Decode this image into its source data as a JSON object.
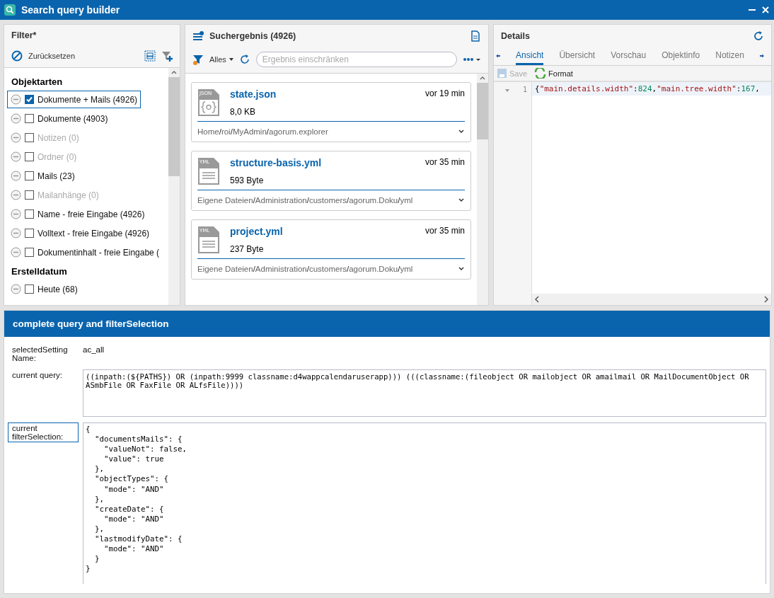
{
  "window": {
    "title": "Search query builder"
  },
  "filter": {
    "title": "Filter*",
    "reset": "Zurücksetzen",
    "groups": [
      {
        "title": "Objektarten",
        "items": [
          {
            "label": "Dokumente + Mails (4926)",
            "checked": true,
            "disabled": false,
            "selected": true
          },
          {
            "label": "Dokumente (4903)",
            "checked": false,
            "disabled": false,
            "selected": false
          },
          {
            "label": "Notizen (0)",
            "checked": false,
            "disabled": true,
            "selected": false
          },
          {
            "label": "Ordner (0)",
            "checked": false,
            "disabled": true,
            "selected": false
          },
          {
            "label": "Mails (23)",
            "checked": false,
            "disabled": false,
            "selected": false
          },
          {
            "label": "Mailanhänge (0)",
            "checked": false,
            "disabled": true,
            "selected": false
          },
          {
            "label": "Name - freie Eingabe (4926)",
            "checked": false,
            "disabled": false,
            "selected": false
          },
          {
            "label": "Volltext - freie Eingabe (4926)",
            "checked": false,
            "disabled": false,
            "selected": false
          },
          {
            "label": "Dokumentinhalt - freie Eingabe (",
            "checked": false,
            "disabled": false,
            "selected": false
          }
        ]
      },
      {
        "title": "Erstelldatum",
        "items": [
          {
            "label": "Heute (68)",
            "checked": false,
            "disabled": false,
            "selected": false
          }
        ]
      }
    ]
  },
  "results": {
    "title": "Suchergebnis (4926)",
    "scope": "Alles",
    "search": {
      "placeholder": "Ergebnis einschränken"
    },
    "items": [
      {
        "separator": "/",
        "name": "state.json",
        "kind": "json",
        "type_label": "JSON",
        "size": "8,0 KB",
        "time": "vor 19 min",
        "path": [
          "Home",
          "roi",
          "MyAdmin",
          "agorum.explorer"
        ]
      },
      {
        "separator": "/",
        "name": "structure-basis.yml",
        "kind": "yml",
        "type_label": "YML",
        "size": "593 Byte",
        "time": "vor 35 min",
        "path": [
          "Eigene Dateien",
          "Administration",
          "customers",
          "agorum.Doku",
          "yml"
        ]
      },
      {
        "separator": "/",
        "name": "project.yml",
        "kind": "yml",
        "type_label": "YML",
        "size": "237 Byte",
        "time": "vor 35 min",
        "path": [
          "Eigene Dateien",
          "Administration",
          "customers",
          "agorum.Doku",
          "yml"
        ]
      }
    ]
  },
  "details": {
    "title": "Details",
    "tabs": [
      {
        "label": "Ansicht",
        "selected": true
      },
      {
        "label": "Übersicht",
        "selected": false
      },
      {
        "label": "Vorschau",
        "selected": false
      },
      {
        "label": "Objektinfo",
        "selected": false
      },
      {
        "label": "Notizen",
        "selected": false
      }
    ],
    "save": {
      "label": "Save",
      "disabled": true
    },
    "format": "Format",
    "editor": {
      "line_number": "1",
      "tokens": [
        {
          "kind": "punct",
          "text": "{"
        },
        {
          "kind": "string",
          "text": "\"main.details.width\""
        },
        {
          "kind": "punct",
          "text": ":"
        },
        {
          "kind": "number",
          "text": "824"
        },
        {
          "kind": "punct",
          "text": ","
        },
        {
          "kind": "string",
          "text": "\"main.tree.width\""
        },
        {
          "kind": "punct",
          "text": ":"
        },
        {
          "kind": "number",
          "text": "167"
        },
        {
          "kind": "punct",
          "text": ","
        }
      ]
    }
  },
  "query_panel": {
    "title": "complete query and filterSelection",
    "fields": [
      {
        "label": "selectedSetting Name:",
        "kind": "text",
        "value": "ac_all",
        "focused": false
      },
      {
        "label": "current query:",
        "kind": "box",
        "value": "((inpath:(${PATHS}) OR (inpath:9999 classname:d4wappcalendaruserapp))) (((classname:(fileobject OR mailobject OR amailmail OR MailDocumentObject OR ASmbFile OR FaxFile OR ALfsFile))))",
        "focused": false
      },
      {
        "label": "current filterSelection:",
        "kind": "code",
        "value": "{\n  \"documentsMails\": {\n    \"valueNot\": false,\n    \"value\": true\n  },\n  \"objectTypes\": {\n    \"mode\": \"AND\"\n  },\n  \"createDate\": {\n    \"mode\": \"AND\"\n  },\n  \"lastmodifyDate\": {\n    \"mode\": \"AND\"\n  }\n}",
        "focused": true
      }
    ]
  }
}
